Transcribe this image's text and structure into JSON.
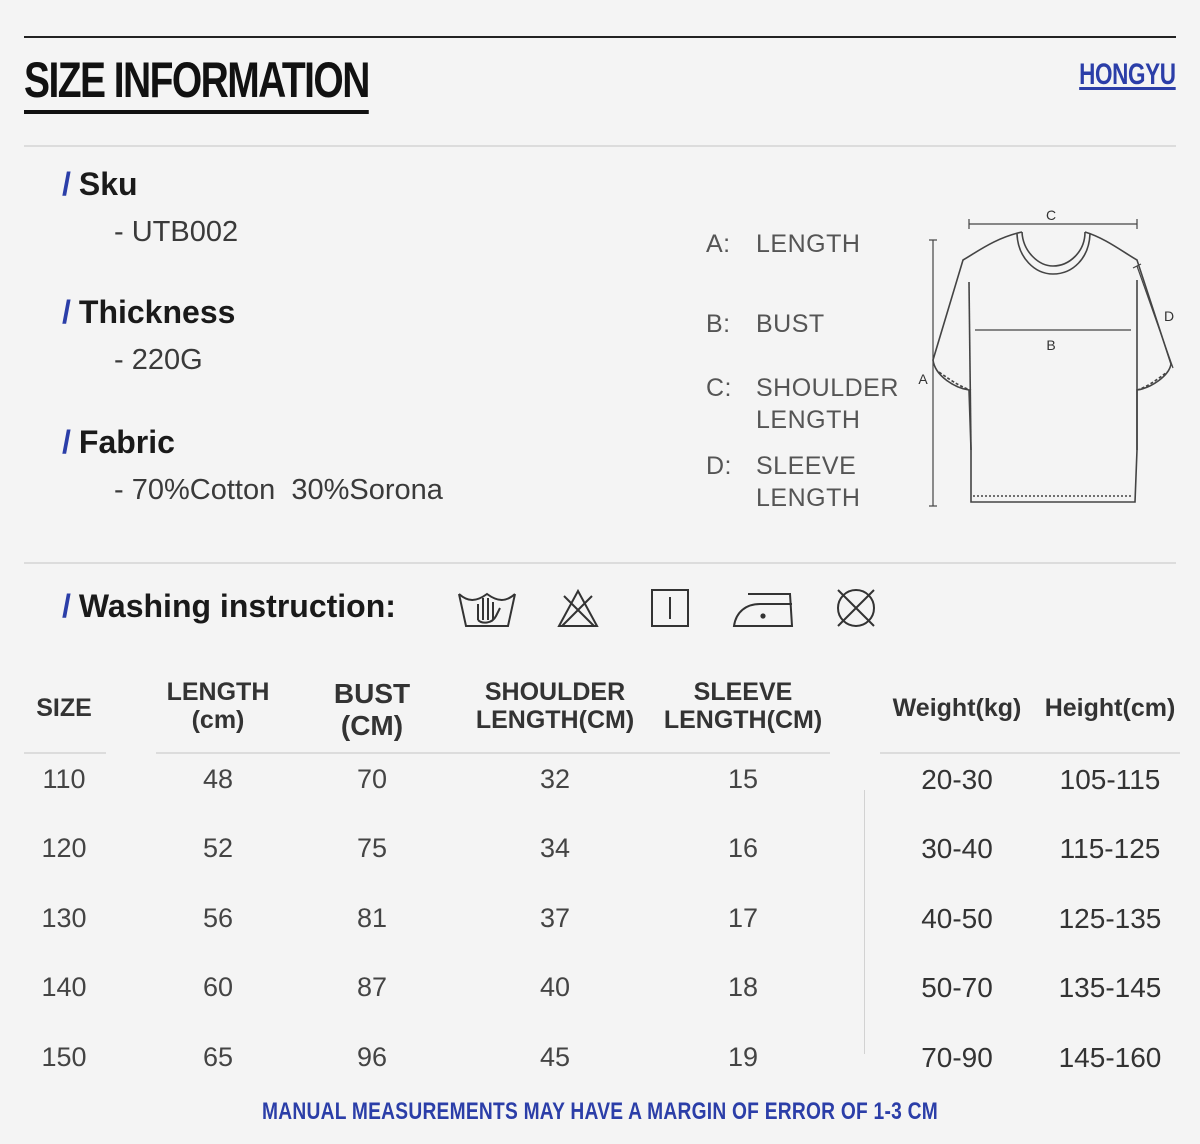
{
  "header": {
    "title": "SIZE INFORMATION",
    "brand": "HONGYU"
  },
  "specs": [
    {
      "label": "Sku",
      "value": "- UTB002"
    },
    {
      "label": "Thickness",
      "value": "- 220G"
    },
    {
      "label": "Fabric",
      "value": "- 70%Cotton  30%Sorona"
    }
  ],
  "legend": [
    {
      "key": "A:",
      "line1": "LENGTH",
      "line2": ""
    },
    {
      "key": "B:",
      "line1": "BUST",
      "line2": ""
    },
    {
      "key": "C:",
      "line1": "SHOULDER",
      "line2": "LENGTH"
    },
    {
      "key": "D:",
      "line1": "SLEEVE",
      "line2": "LENGTH"
    }
  ],
  "diagram_labels": {
    "a": "A",
    "b": "B",
    "c": "C",
    "d": "D"
  },
  "washing": {
    "label": "Washing instruction:",
    "icons": [
      "hand-wash-icon",
      "do-not-bleach-icon",
      "tumble-dry-icon",
      "iron-icon",
      "do-not-dry-clean-icon"
    ]
  },
  "table": {
    "headers": [
      {
        "line1": "SIZE",
        "line2": ""
      },
      {
        "line1": "LENGTH",
        "line2": "(cm)"
      },
      {
        "line1": "BUST",
        "line2": "(CM)"
      },
      {
        "line1": "SHOULDER",
        "line2": "LENGTH(CM)"
      },
      {
        "line1": "SLEEVE",
        "line2": "LENGTH(CM)"
      }
    ],
    "rows": [
      [
        "110",
        "48",
        "70",
        "32",
        "15"
      ],
      [
        "120",
        "52",
        "75",
        "34",
        "16"
      ],
      [
        "130",
        "56",
        "81",
        "37",
        "17"
      ],
      [
        "140",
        "60",
        "87",
        "40",
        "18"
      ],
      [
        "150",
        "65",
        "96",
        "45",
        "19"
      ]
    ]
  },
  "fit_table": {
    "headers": [
      "Weight(kg)",
      "Height(cm)"
    ],
    "rows": [
      [
        "20-30",
        "105-115"
      ],
      [
        "30-40",
        "115-125"
      ],
      [
        "40-50",
        "125-135"
      ],
      [
        "50-70",
        "135-145"
      ],
      [
        "70-90",
        "145-160"
      ]
    ]
  },
  "note": "MANUAL MEASUREMENTS MAY HAVE A MARGIN OF ERROR OF 1-3 CM",
  "colors": {
    "accent": "#2b3ea8",
    "text": "#2b2b2b",
    "background": "#f4f4f4"
  }
}
